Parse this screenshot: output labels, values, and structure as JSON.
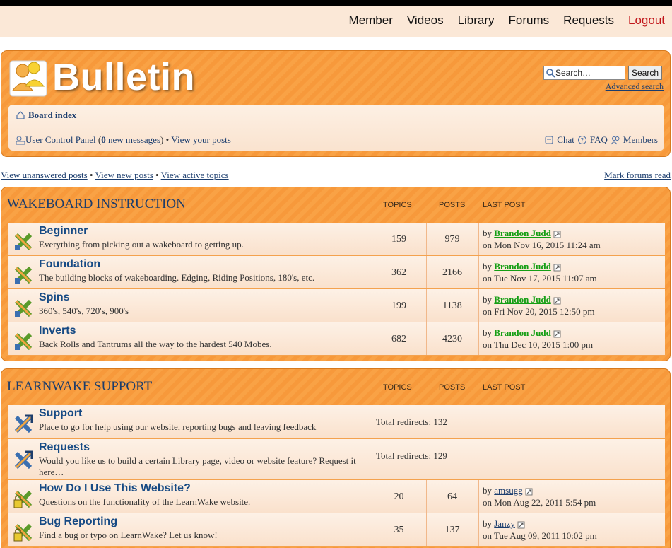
{
  "topnav": {
    "items": [
      "Member",
      "Videos",
      "Library",
      "Forums",
      "Requests"
    ],
    "logout": "Logout"
  },
  "header": {
    "site_title": "Bulletin",
    "search_placeholder": "Search…",
    "search_button": "Search",
    "advanced_search": "Advanced search",
    "board_index": "Board index",
    "ucp": "User Control Panel",
    "messages_count": "0",
    "messages_suffix": "new messages",
    "view_posts": "View your posts",
    "chat": "Chat",
    "faq": "FAQ",
    "members": "Members"
  },
  "links": {
    "unanswered": "View unanswered posts",
    "new_posts": "View new posts",
    "active": "View active topics",
    "mark_read": "Mark forums read"
  },
  "columns": {
    "topics": "TOPICS",
    "posts": "POSTS",
    "last_post": "LAST POST"
  },
  "sections": [
    {
      "title": "WAKEBOARD INSTRUCTION",
      "forums": [
        {
          "name": "Beginner",
          "desc": "Everything from picking out a wakeboard to getting up.",
          "topics": "159",
          "posts": "979",
          "by": "by",
          "user": "Brandon Judd",
          "date": "on Mon Nov 16, 2015 11:24 am"
        },
        {
          "name": "Foundation",
          "desc": "The building blocks of wakeboarding. Edging, Riding Positions, 180's, etc.",
          "topics": "362",
          "posts": "2166",
          "by": "by",
          "user": "Brandon Judd",
          "date": "on Tue Nov 17, 2015 11:07 am"
        },
        {
          "name": "Spins",
          "desc": "360's, 540's, 720's, 900's",
          "topics": "199",
          "posts": "1138",
          "by": "by",
          "user": "Brandon Judd",
          "date": "on Fri Nov 20, 2015 12:50 pm"
        },
        {
          "name": "Inverts",
          "desc": "Back Rolls and Tantrums all the way to the hardest 540 Mobes.",
          "topics": "682",
          "posts": "4230",
          "by": "by",
          "user": "Brandon Judd",
          "date": "on Thu Dec 10, 2015 1:00 pm"
        }
      ]
    },
    {
      "title": "LEARNWAKE SUPPORT",
      "forums": [
        {
          "name": "Support",
          "desc": "Place to go for help using our website, reporting bugs and leaving feedback",
          "redirects": "Total redirects: 132"
        },
        {
          "name": "Requests",
          "desc": "Would you like us to build a certain Library page, video or website feature? Request it here…",
          "redirects": "Total redirects: 129"
        },
        {
          "name": "How Do I Use This Website?",
          "desc": "Questions on the functionality of the LearnWake website.",
          "topics": "20",
          "posts": "64",
          "by": "by",
          "user": "amsugg",
          "date": "on Mon Aug 22, 2011 5:54 pm"
        },
        {
          "name": "Bug Reporting",
          "desc": "Find a bug or typo on LearnWake? Let us know!",
          "topics": "35",
          "posts": "137",
          "by": "by",
          "user": "Janzy",
          "date": "on Tue Aug 09, 2011 10:02 pm"
        }
      ]
    }
  ]
}
